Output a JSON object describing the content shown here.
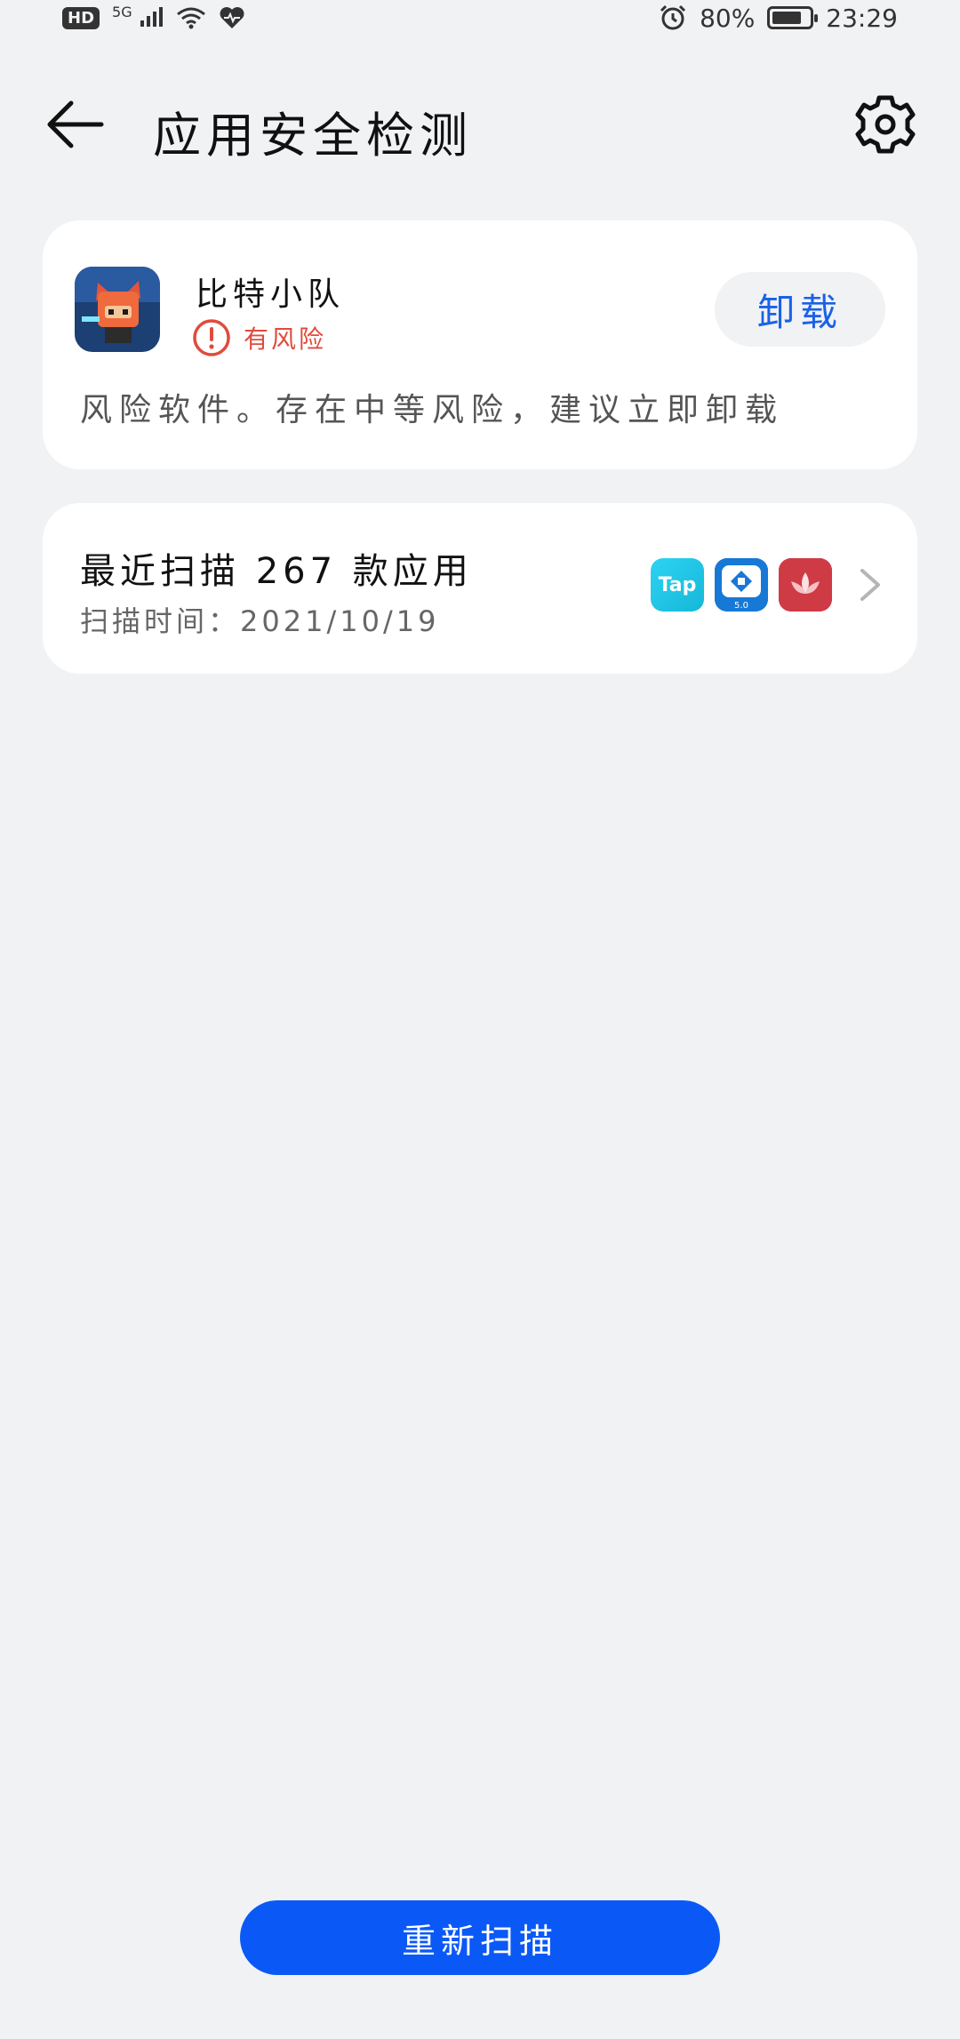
{
  "status_bar": {
    "left_badge": "HD",
    "network": "5G",
    "battery_percent": "80%",
    "battery_level": 0.8,
    "time": "23:29"
  },
  "header": {
    "title": "应用安全检测"
  },
  "risk_card": {
    "app_name": "比特小队",
    "status": "有风险",
    "uninstall_label": "卸载",
    "description": "风险软件。存在中等风险，建议立即卸载"
  },
  "scan_card": {
    "title": "最近扫描 267 款应用",
    "time_label": "扫描时间：2021/10/19",
    "icons": [
      "Tap",
      "5.0",
      "lotus"
    ]
  },
  "footer": {
    "rescan_label": "重新扫描"
  },
  "colors": {
    "background": "#f1f2f4",
    "accent": "#0a59f7",
    "risk": "#e04b3c"
  }
}
